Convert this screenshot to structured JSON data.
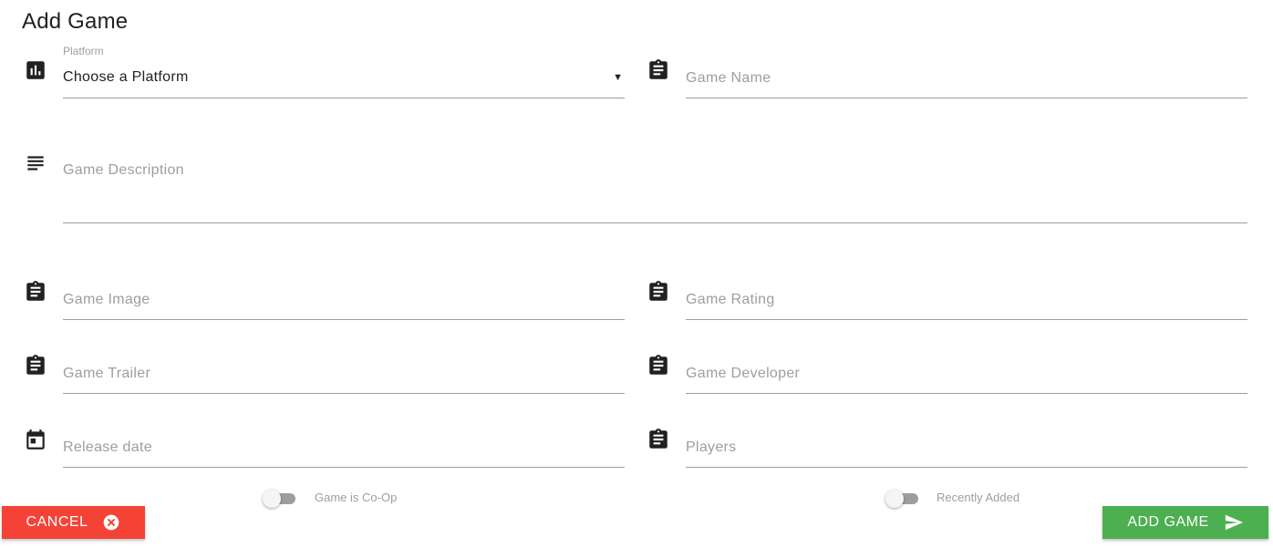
{
  "page": {
    "title": "Add Game"
  },
  "form": {
    "platform": {
      "label": "Platform",
      "value": "Choose a Platform",
      "icon": "bar-chart-icon"
    },
    "game_name": {
      "placeholder": "Game Name",
      "icon": "clipboard-icon"
    },
    "game_description": {
      "placeholder": "Game Description",
      "icon": "text-lines-icon"
    },
    "game_image": {
      "placeholder": "Game Image",
      "icon": "clipboard-icon"
    },
    "game_rating": {
      "placeholder": "Game Rating",
      "icon": "clipboard-icon"
    },
    "game_trailer": {
      "placeholder": "Game Trailer",
      "icon": "clipboard-icon"
    },
    "game_developer": {
      "placeholder": "Game Developer",
      "icon": "clipboard-icon"
    },
    "release_date": {
      "placeholder": "Release date",
      "icon": "calendar-icon"
    },
    "players": {
      "placeholder": "Players",
      "icon": "clipboard-icon"
    },
    "coop_switch": {
      "label": "Game is Co-Op",
      "checked": false
    },
    "recent_switch": {
      "label": "Recently Added",
      "checked": false
    }
  },
  "actions": {
    "cancel_label": "CANCEL",
    "add_label": "ADD GAME"
  },
  "colors": {
    "cancel": "#f44336",
    "add": "#4caf50",
    "underline": "#9e9e9e",
    "placeholder": "#9e9e9e"
  }
}
